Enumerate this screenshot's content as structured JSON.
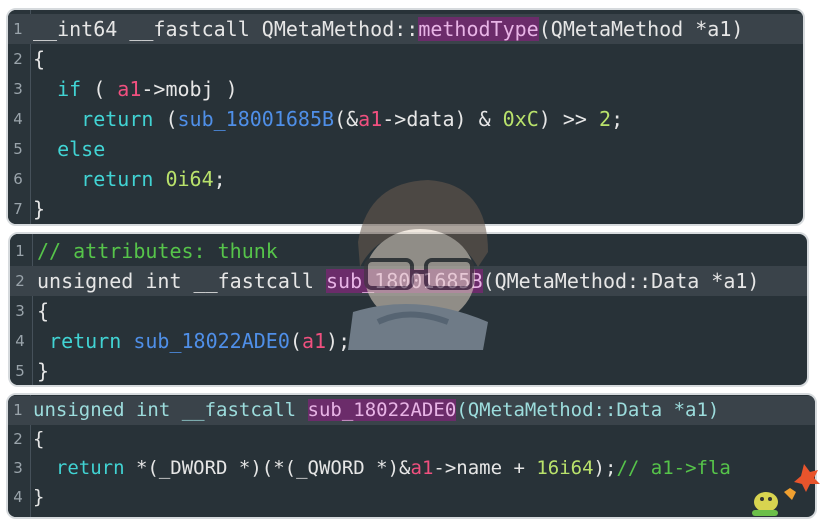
{
  "panels": [
    {
      "lines": [
        {
          "n": "1",
          "tokens": [
            {
              "t": "__int64 __fastcall QMetaMethod::",
              "c": "pl"
            },
            {
              "t": "methodType",
              "c": "hl"
            },
            {
              "t": "(QMetaMethod *a1)",
              "c": "pl"
            }
          ]
        },
        {
          "n": "2",
          "tokens": [
            {
              "t": "{",
              "c": "pl"
            }
          ]
        },
        {
          "n": "3",
          "tokens": [
            {
              "t": "  if",
              "c": "kw"
            },
            {
              "t": " ( ",
              "c": "pl"
            },
            {
              "t": "a1",
              "c": "var"
            },
            {
              "t": "->mobj )",
              "c": "pl"
            }
          ]
        },
        {
          "n": "4",
          "tokens": [
            {
              "t": "    return",
              "c": "kw"
            },
            {
              "t": " (",
              "c": "pl"
            },
            {
              "t": "sub_18001685B",
              "c": "fn"
            },
            {
              "t": "(&",
              "c": "pl"
            },
            {
              "t": "a1",
              "c": "var"
            },
            {
              "t": "->data) & ",
              "c": "pl"
            },
            {
              "t": "0xC",
              "c": "num"
            },
            {
              "t": ") >> ",
              "c": "pl"
            },
            {
              "t": "2",
              "c": "num"
            },
            {
              "t": ";",
              "c": "pl"
            }
          ]
        },
        {
          "n": "5",
          "tokens": [
            {
              "t": "  else",
              "c": "kw"
            }
          ]
        },
        {
          "n": "6",
          "tokens": [
            {
              "t": "    return",
              "c": "kw"
            },
            {
              "t": " ",
              "c": "pl"
            },
            {
              "t": "0i64",
              "c": "num"
            },
            {
              "t": ";",
              "c": "pl"
            }
          ]
        },
        {
          "n": "7",
          "tokens": [
            {
              "t": "}",
              "c": "pl"
            }
          ]
        }
      ]
    },
    {
      "lines": [
        {
          "n": "1",
          "tokens": [
            {
              "t": "// attributes: thunk",
              "c": "cmt"
            }
          ]
        },
        {
          "n": "2",
          "tokens": [
            {
              "t": "unsigned int __fastcall ",
              "c": "pl"
            },
            {
              "t": "sub_18001685B",
              "c": "hl"
            },
            {
              "t": "(QMetaMethod::Data *a1)",
              "c": "pl"
            }
          ]
        },
        {
          "n": "3",
          "tokens": [
            {
              "t": "{",
              "c": "pl"
            }
          ]
        },
        {
          "n": "4",
          "tokens": [
            {
              "t": " return",
              "c": "kw"
            },
            {
              "t": " ",
              "c": "pl"
            },
            {
              "t": "sub_18022ADE0",
              "c": "fn"
            },
            {
              "t": "(",
              "c": "pl"
            },
            {
              "t": "a1",
              "c": "var"
            },
            {
              "t": ");",
              "c": "pl"
            }
          ]
        },
        {
          "n": "5",
          "tokens": [
            {
              "t": "}",
              "c": "pl"
            }
          ]
        }
      ]
    },
    {
      "lines": [
        {
          "n": "1",
          "tokens": [
            {
              "t": "unsigned int __fastcall ",
              "c": "ty"
            },
            {
              "t": "sub_18022ADE0",
              "c": "hl"
            },
            {
              "t": "(QMetaMethod::Data *a1)",
              "c": "ty"
            }
          ]
        },
        {
          "n": "2",
          "tokens": [
            {
              "t": "{",
              "c": "pl"
            }
          ]
        },
        {
          "n": "3",
          "tokens": [
            {
              "t": "  return",
              "c": "kw"
            },
            {
              "t": " *(_DWORD *)(*(_QWORD *)&",
              "c": "pl"
            },
            {
              "t": "a1",
              "c": "var"
            },
            {
              "t": "->name + ",
              "c": "pl"
            },
            {
              "t": "16i64",
              "c": "num"
            },
            {
              "t": ");",
              "c": "pl"
            },
            {
              "t": "// a1->fla",
              "c": "cmt"
            }
          ]
        },
        {
          "n": "4",
          "tokens": [
            {
              "t": "}",
              "c": "pl"
            }
          ]
        }
      ]
    }
  ]
}
